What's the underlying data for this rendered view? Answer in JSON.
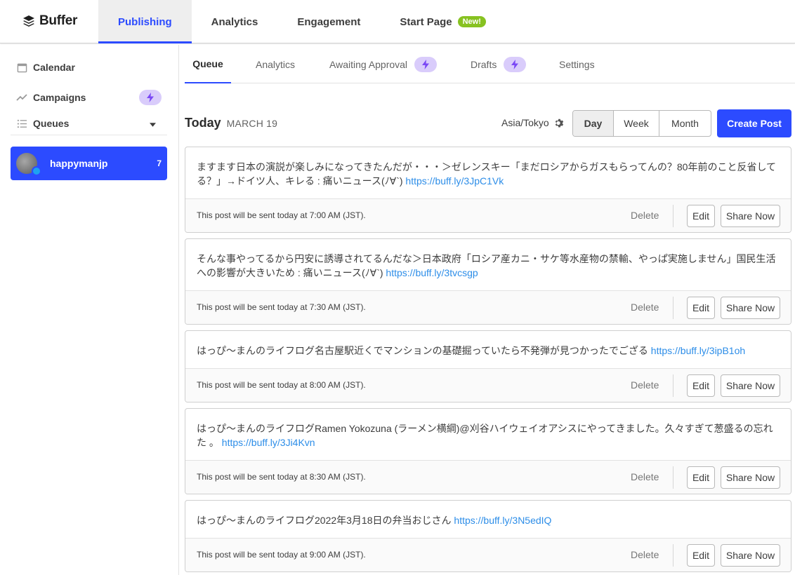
{
  "brand": {
    "name": "Buffer",
    "accent": "#2c4bff",
    "new_badge_color": "#87c221",
    "link_color": "#2c8de8"
  },
  "topnav": {
    "items": [
      {
        "label": "Publishing",
        "active": true
      },
      {
        "label": "Analytics",
        "active": false
      },
      {
        "label": "Engagement",
        "active": false
      },
      {
        "label": "Start Page",
        "active": false,
        "badge": "New!"
      }
    ]
  },
  "sidebar": {
    "items": [
      {
        "label": "Calendar",
        "icon": "calendar-icon"
      },
      {
        "label": "Campaigns",
        "icon": "trend-icon",
        "badge_icon": "bolt-icon"
      },
      {
        "label": "Queues",
        "icon": "list-icon",
        "trailing_icon": "caret-down-icon"
      }
    ],
    "profile": {
      "name": "happymanjp",
      "count": "7",
      "network": "twitter"
    }
  },
  "subtabs": [
    {
      "label": "Queue",
      "active": true
    },
    {
      "label": "Analytics",
      "active": false
    },
    {
      "label": "Awaiting Approval",
      "active": false,
      "badge_icon": "bolt-icon"
    },
    {
      "label": "Drafts",
      "active": false,
      "badge_icon": "bolt-icon"
    },
    {
      "label": "Settings",
      "active": false
    }
  ],
  "header": {
    "today": "Today",
    "date": "MARCH 19",
    "timezone": "Asia/Tokyo",
    "views": [
      "Day",
      "Week",
      "Month"
    ],
    "active_view": "Day",
    "create_label": "Create Post"
  },
  "post_actions": {
    "delete": "Delete",
    "edit": "Edit",
    "share": "Share Now"
  },
  "posts": [
    {
      "text": "ますます日本の演説が楽しみになってきたんだが・・・＞ゼレンスキー「まだロシアからガスもらってんの？80年前のこと反省してる？」→ドイツ人、キレる : 痛いニュース(ﾉ∀`) ",
      "link": "https://buff.ly/3JpC1Vk",
      "schedule": "This post will be sent today at 7:00 AM (JST)."
    },
    {
      "text": "そんな事やってるから円安に誘導されてるんだな＞日本政府「ロシア産カニ・サケ等水産物の禁輸、やっぱ実施しません」国民生活への影響が大きいため : 痛いニュース(ﾉ∀`) ",
      "link": "https://buff.ly/3tvcsgp",
      "schedule": "This post will be sent today at 7:30 AM (JST)."
    },
    {
      "text": "はっぴ〜まんのライフログ名古屋駅近くでマンションの基礎掘っていたら不発弾が見つかったでござる ",
      "link": "https://buff.ly/3ipB1oh",
      "schedule": "This post will be sent today at 8:00 AM (JST)."
    },
    {
      "text": "はっぴ〜まんのライフログRamen Yokozuna (ラーメン横綱)@刈谷ハイウェイオアシスにやってきました。久々すぎて葱盛るの忘れた 。 ",
      "link": "https://buff.ly/3Ji4Kvn",
      "schedule": "This post will be sent today at 8:30 AM (JST)."
    },
    {
      "text": "はっぴ〜まんのライフログ2022年3月18日の弁当おじさん ",
      "link": "https://buff.ly/3N5edIQ",
      "schedule": "This post will be sent today at 9:00 AM (JST)."
    }
  ]
}
